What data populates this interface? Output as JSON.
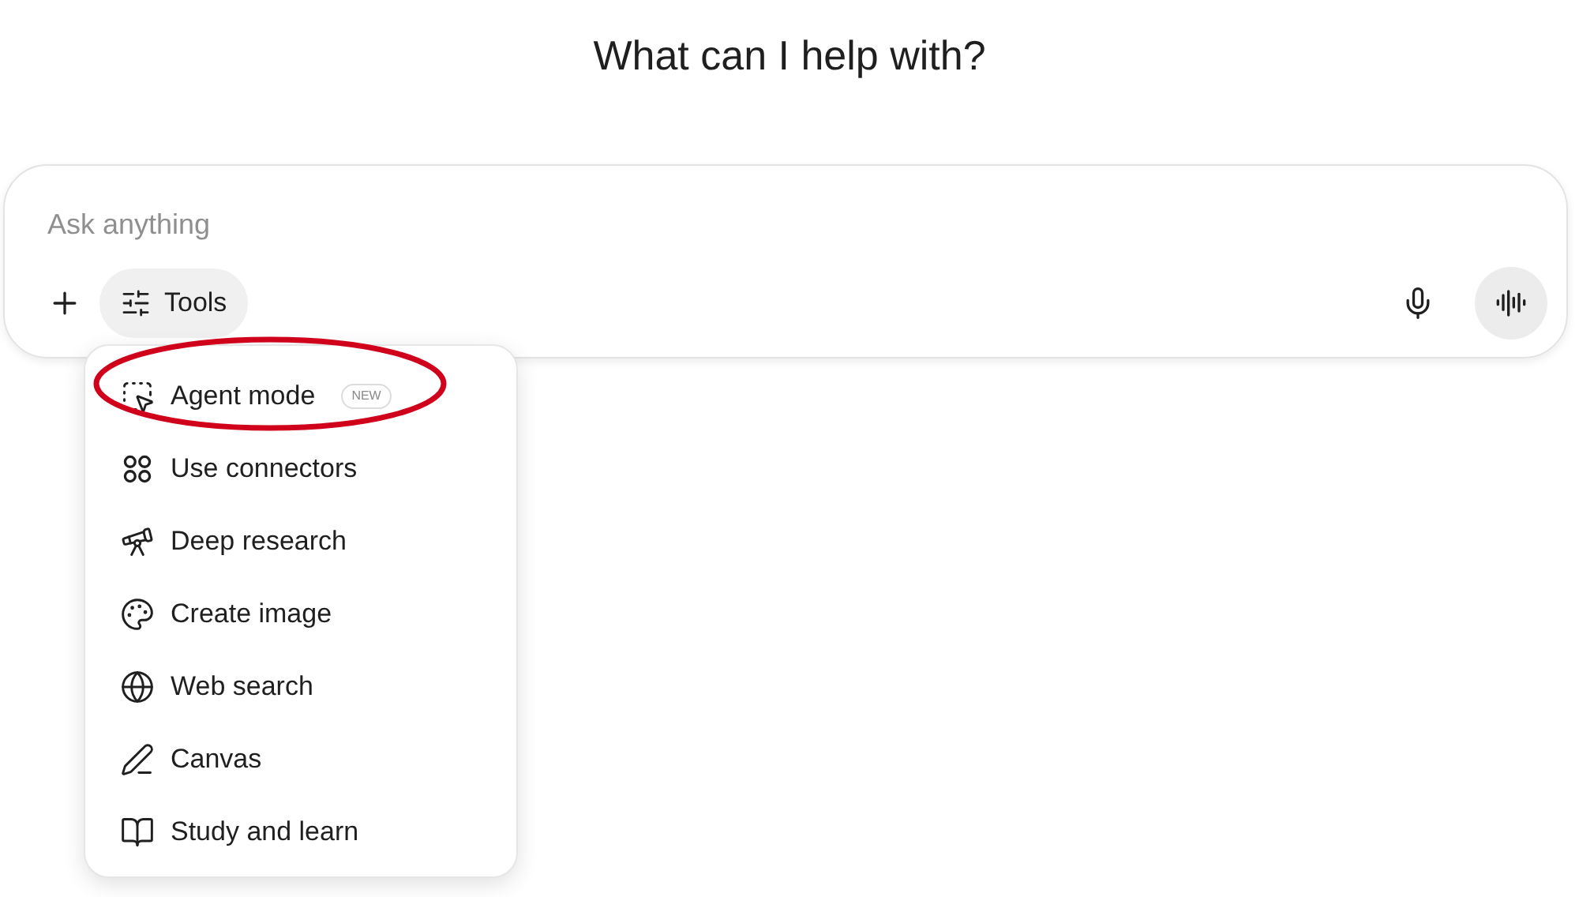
{
  "heading": "What can I help with?",
  "composer": {
    "placeholder": "Ask anything",
    "tools_button": "Tools"
  },
  "tools_menu": {
    "items": [
      {
        "label": "Agent mode",
        "badge": "NEW",
        "annotated": true
      },
      {
        "label": "Use connectors",
        "annotated": false
      },
      {
        "label": "Deep research",
        "annotated": false
      },
      {
        "label": "Create image",
        "annotated": false
      },
      {
        "label": "Web search",
        "annotated": false
      },
      {
        "label": "Canvas",
        "annotated": false
      },
      {
        "label": "Study and learn",
        "annotated": false
      }
    ]
  }
}
